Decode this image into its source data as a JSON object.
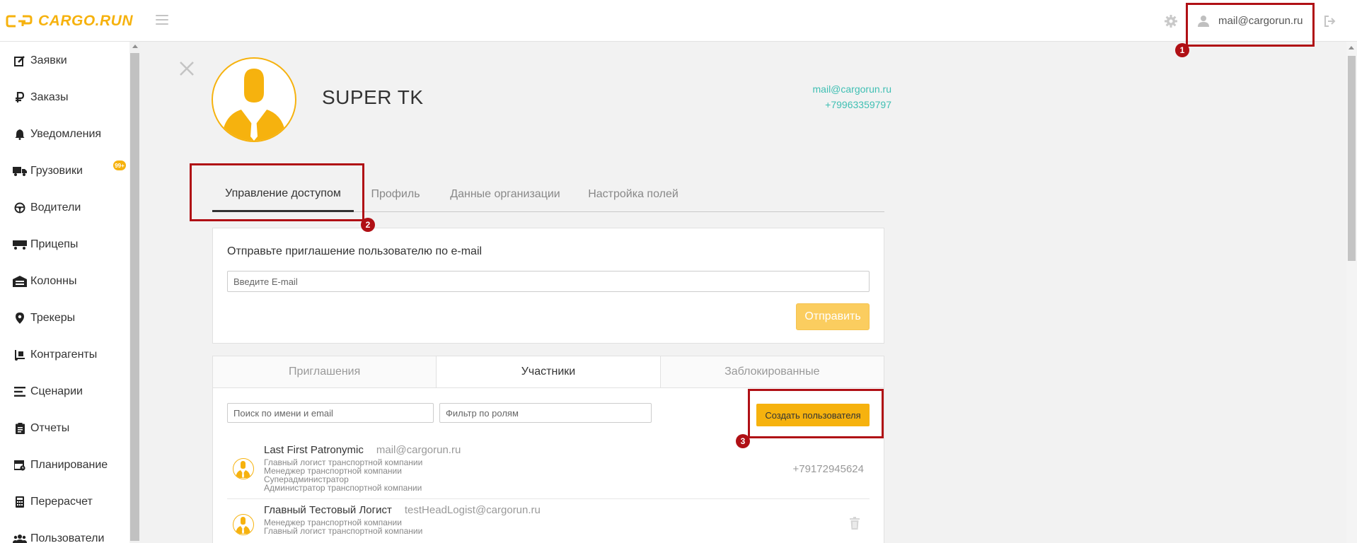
{
  "header": {
    "logo_text": "CARGO.RUN",
    "user_email": "mail@cargorun.ru",
    "accent_color": "#f6b20e"
  },
  "sidebar": {
    "items": [
      {
        "label": "Заявки",
        "icon": "edit-icon"
      },
      {
        "label": "Заказы",
        "icon": "ruble-icon"
      },
      {
        "label": "Уведомления",
        "icon": "bell-icon"
      },
      {
        "label": "Грузовики",
        "icon": "truck-icon"
      },
      {
        "label": "Водители",
        "icon": "steering-wheel-icon"
      },
      {
        "label": "Прицепы",
        "icon": "trailer-icon"
      },
      {
        "label": "Колонны",
        "icon": "garage-icon"
      },
      {
        "label": "Трекеры",
        "icon": "map-marker-icon"
      },
      {
        "label": "Контрагенты",
        "icon": "dolly-icon"
      },
      {
        "label": "Сценарии",
        "icon": "list-icon"
      },
      {
        "label": "Отчеты",
        "icon": "clipboard-icon"
      },
      {
        "label": "Планирование",
        "icon": "calendar-icon"
      },
      {
        "label": "Перерасчет",
        "icon": "calculator-icon"
      },
      {
        "label": "Пользователи",
        "icon": "users-icon"
      }
    ],
    "notification_badge": "99+"
  },
  "profile": {
    "name": "SUPER TK",
    "email": "mail@cargorun.ru",
    "phone": "+79963359797"
  },
  "tabs": [
    {
      "label": "Управление доступом",
      "active": true
    },
    {
      "label": "Профиль",
      "active": false
    },
    {
      "label": "Данные организации",
      "active": false
    },
    {
      "label": "Настройка полей",
      "active": false
    }
  ],
  "invite": {
    "title": "Отправьте приглашение пользователю по e-mail",
    "email_placeholder": "Введите E-mail",
    "send_label": "Отправить"
  },
  "members": {
    "subtabs": [
      {
        "label": "Приглашения",
        "active": false
      },
      {
        "label": "Участники",
        "active": true
      },
      {
        "label": "Заблокированные",
        "active": false
      }
    ],
    "search_placeholder": "Поиск по имени и email",
    "role_placeholder": "Фильтр по ролям",
    "create_label": "Создать пользователя",
    "rows": [
      {
        "name": "Last First Patronymic",
        "email": "mail@cargorun.ru",
        "roles": [
          "Главный логист транспортной компании",
          "Менеджер транспортной компании",
          "Суперадминистратор",
          "Администратор транспортной компании"
        ],
        "phone": "+79172945624"
      },
      {
        "name": "Главный Тестовый Логист",
        "email": "testHeadLogist@cargorun.ru",
        "roles": [
          "Менеджер транспортной компании",
          "Главный логист транспортной компании"
        ],
        "phone": ""
      }
    ]
  },
  "annotations": [
    "1",
    "2",
    "3"
  ]
}
